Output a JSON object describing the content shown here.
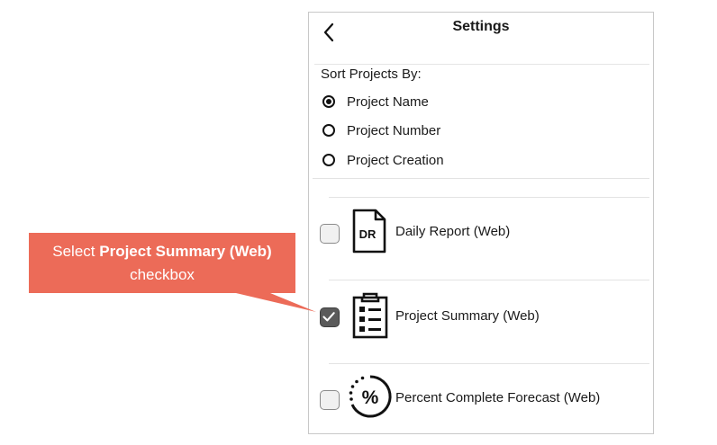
{
  "header": {
    "title": "Settings",
    "back_icon": "chevron-left-icon"
  },
  "sort": {
    "label": "Sort Projects By:",
    "options": [
      {
        "label": "Project Name",
        "selected": true
      },
      {
        "label": "Project Number",
        "selected": false
      },
      {
        "label": "Project Creation",
        "selected": false
      }
    ]
  },
  "reports": [
    {
      "label": "Daily Report (Web)",
      "checked": false,
      "icon": "daily-report-icon",
      "icon_text": "DR"
    },
    {
      "label": "Project Summary (Web)",
      "checked": true,
      "icon": "clipboard-list-icon"
    },
    {
      "label": "Percent Complete Forecast (Web)",
      "checked": false,
      "icon": "percent-forecast-icon",
      "icon_text": "%"
    }
  ],
  "callout": {
    "prefix": "Select ",
    "emphasis": "Project Summary (Web)",
    "suffix": "checkbox",
    "color": "#ec6b58"
  }
}
